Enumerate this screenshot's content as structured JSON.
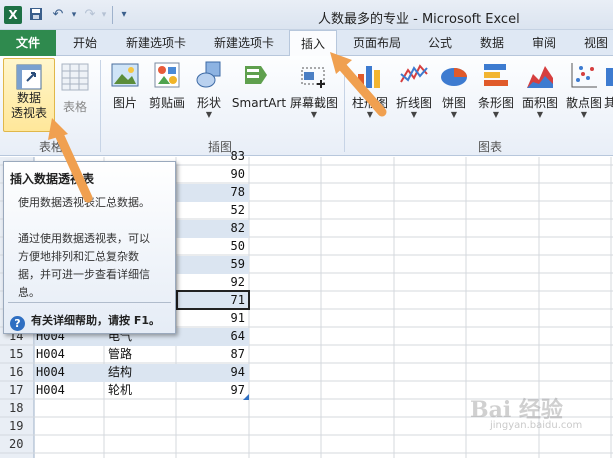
{
  "window": {
    "title": "人数最多的专业 - Microsoft Excel",
    "app_icon": "X"
  },
  "qat": {
    "save": "save-icon",
    "undo": "undo-icon",
    "redo": "redo-icon"
  },
  "tabs": [
    {
      "label": "文件"
    },
    {
      "label": "开始"
    },
    {
      "label": "新建选项卡"
    },
    {
      "label": "新建选项卡"
    },
    {
      "label": "插入"
    },
    {
      "label": "页面布局"
    },
    {
      "label": "公式"
    },
    {
      "label": "数据"
    },
    {
      "label": "审阅"
    },
    {
      "label": "视图"
    }
  ],
  "ribbon": {
    "tables": {
      "pivot_line1": "数据",
      "pivot_line2": "透视表",
      "table": "表格",
      "group": "表格"
    },
    "illustrations": {
      "picture": "图片",
      "clipart": "剪贴画",
      "shapes": "形状",
      "smartart": "SmartArt",
      "screenshot": "屏幕截图",
      "group": "插图"
    },
    "charts": {
      "column": "柱形图",
      "line": "折线图",
      "pie": "饼图",
      "bar": "条形图",
      "area": "面积图",
      "scatter": "散点图",
      "other": "其",
      "group": "图表"
    }
  },
  "rows": [
    {
      "num": "",
      "code": "",
      "major": "",
      "value": "83"
    },
    {
      "num": "",
      "code": "",
      "major": "",
      "value": "90"
    },
    {
      "num": "",
      "code": "",
      "major": "",
      "value": "78"
    },
    {
      "num": "",
      "code": "",
      "major": "",
      "value": "52"
    },
    {
      "num": "",
      "code": "",
      "major": "",
      "value": "82"
    },
    {
      "num": "",
      "code": "",
      "major": "",
      "value": "50"
    },
    {
      "num": "",
      "code": "",
      "major": "",
      "value": "59"
    },
    {
      "num": "",
      "code": "",
      "major": "",
      "value": "92"
    },
    {
      "num": "",
      "code": "",
      "major": "",
      "value": "71"
    },
    {
      "num": "",
      "code": "",
      "major": "",
      "value": "91"
    },
    {
      "num": "14",
      "code": "H004",
      "major": "电气",
      "value": "64"
    },
    {
      "num": "15",
      "code": "H004",
      "major": "管路",
      "value": "87"
    },
    {
      "num": "16",
      "code": "H004",
      "major": "结构",
      "value": "94"
    },
    {
      "num": "17",
      "code": "H004",
      "major": "轮机",
      "value": "97"
    },
    {
      "num": "18",
      "code": "",
      "major": "",
      "value": ""
    },
    {
      "num": "19",
      "code": "",
      "major": "",
      "value": ""
    },
    {
      "num": "20",
      "code": "",
      "major": "",
      "value": ""
    }
  ],
  "tooltip": {
    "title": "插入数据透视表",
    "line1": "使用数据透视表汇总数据。",
    "line2": "通过使用数据透视表，可以",
    "line3": "方便地排列和汇总复杂数",
    "line4": "据，并可进一步查看详细信",
    "line5": "息。",
    "help": "有关详细帮助，请按 F1。"
  },
  "watermark": {
    "text": "Bai 经验",
    "sub": "jingyan.baidu.com"
  },
  "colors": {
    "file_tab": "#2f8a4e",
    "band": "#dbe5f1",
    "arrow": "#f0a050",
    "pivot_highlight": "#ffe79a"
  }
}
